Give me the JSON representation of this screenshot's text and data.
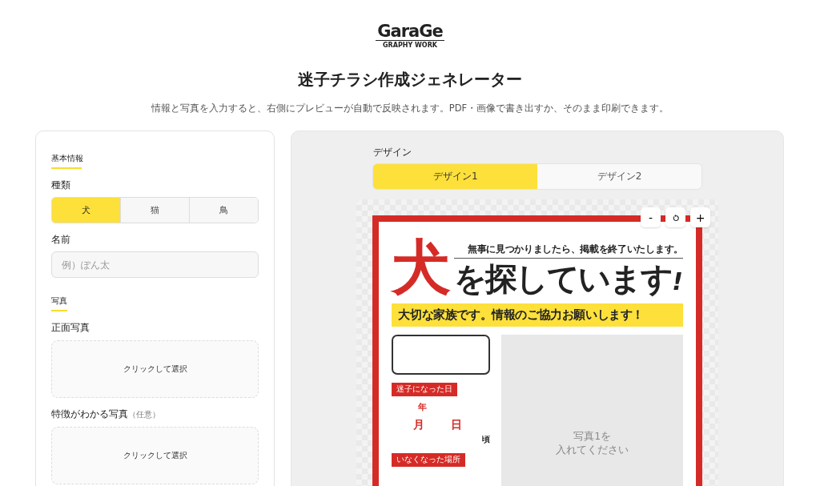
{
  "logo": {
    "name": "GaraGe",
    "tagline": "GRAPHY WORK"
  },
  "title": "迷子チラシ作成ジェネレーター",
  "subtitle": "情報と写真を入力すると、右側にプレビューが自動で反映されます。PDF・画像で書き出すか、そのまま印刷できます。",
  "form": {
    "basic": {
      "heading": "基本情報",
      "species": {
        "label": "種類",
        "options": [
          {
            "label": "犬",
            "selected": true
          },
          {
            "label": "猫",
            "selected": false
          },
          {
            "label": "鳥",
            "selected": false
          }
        ]
      },
      "name": {
        "label": "名前",
        "placeholder": "例）ぽん太"
      }
    },
    "photos": {
      "heading": "写真",
      "uploads": [
        {
          "label": "正面写真",
          "button": "クリックして選択"
        },
        {
          "label": "特徴がわかる写真",
          "note": "（任意）",
          "button": "クリックして選択"
        }
      ]
    }
  },
  "preview": {
    "design": {
      "label": "デザイン",
      "options": [
        {
          "label": "デザイン1",
          "selected": true
        },
        {
          "label": "デザイン2",
          "selected": false
        }
      ]
    },
    "zoom": {
      "out": "-",
      "in": "+"
    },
    "flyer": {
      "notice": "無事に見つかりましたら、掲載を終了いたします。",
      "species": "犬",
      "headline": "を探しています",
      "exclamation": "!",
      "banner": "大切な家族です。情報のご協力お願いします！",
      "date_label": "迷子になった日",
      "year": "年",
      "month": "月",
      "day": "日",
      "approx": "頃",
      "place_label": "いなくなった場所",
      "photo_hint": [
        "写真1を",
        "入れてください"
      ]
    }
  }
}
